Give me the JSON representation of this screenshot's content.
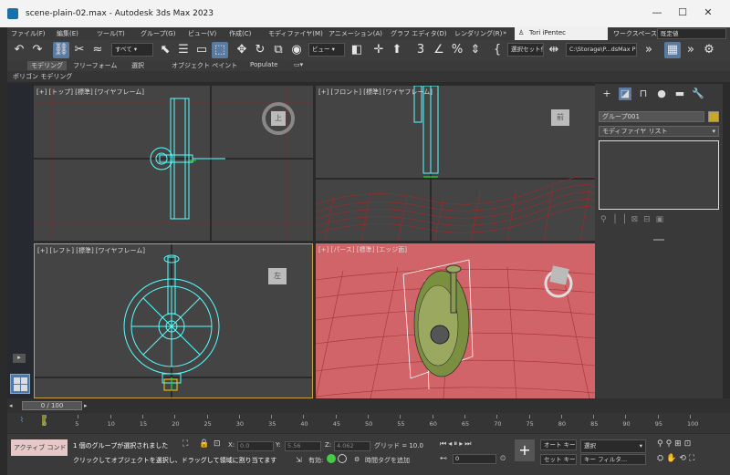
{
  "window": {
    "title": "scene-plain-02.max - Autodesk 3ds Max 2023",
    "minimize": "—",
    "maximize": "☐",
    "close": "✕"
  },
  "menus": [
    "ファイル(F)",
    "編集(E)",
    "ツール(T)",
    "グループ(G)",
    "ビュー(V)",
    "作成(C)",
    "モディファイヤ(M)",
    "アニメーション(A)",
    "グラフ エディタ(D)",
    "レンダリング(R)",
    "»"
  ],
  "user": {
    "name": "Tori iPentec",
    "workspace_label": "ワークスペース:",
    "workspace_value": "既定値"
  },
  "toolbar": {
    "filter": "すべて",
    "view": "ビュー",
    "selset": "選択セット作成",
    "project_path": "C:\\Storage\\P...dsMax Project"
  },
  "ribbon": {
    "tabs": [
      "モデリング",
      "フリーフォーム",
      "選択",
      "オブジェクト ペイント",
      "Populate"
    ],
    "sub": "ポリゴン モデリング"
  },
  "viewports": [
    {
      "label": "[+] [トップ] [標準] [ワイヤフレーム]",
      "cube": "上"
    },
    {
      "label": "[+] [フロント] [標準] [ワイヤフレーム]",
      "cube": "前"
    },
    {
      "label": "[+] [レフト] [標準] [ワイヤフレーム]",
      "cube": "左"
    },
    {
      "label": "[+] [パース] [標準] [エッジ面]",
      "cube": ""
    }
  ],
  "command_panel": {
    "object_name": "グループ001",
    "modifier_list": "モディファイヤ リスト"
  },
  "timeline": {
    "frame": "0 / 100",
    "ticks": [
      "0",
      "5",
      "10",
      "15",
      "20",
      "25",
      "30",
      "35",
      "40",
      "45",
      "50",
      "55",
      "60",
      "65",
      "70",
      "75",
      "80",
      "85",
      "90",
      "95",
      "100"
    ]
  },
  "status": {
    "command_line": "アクティブ コンド",
    "selection_msg": "1 個のグループが選択されました",
    "prompt": "クリックしてオブジェクトを選択し、ドラッグして領域に割り当てます",
    "x_label": "X:",
    "x": "0.0",
    "y_label": "Y:",
    "y": "5.56",
    "z_label": "Z:",
    "z": "4.062",
    "grid": "グリッド = 10.0",
    "enabled": "有効:",
    "add_time_tag": "時間タグを追加",
    "autokey": "オート キー",
    "setkey": "セット キー",
    "selected": "選択",
    "key_filter": "キー フィルタ...",
    "frame_field": "0"
  }
}
